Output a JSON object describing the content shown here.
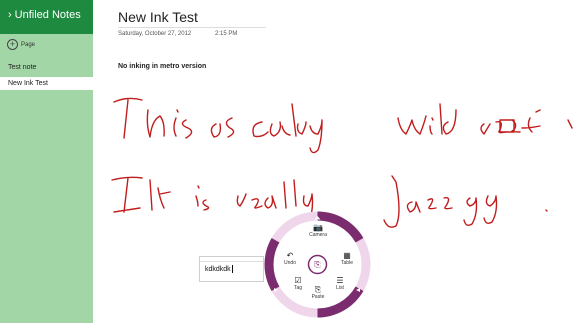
{
  "sidebar": {
    "notebook_title": "Unfiled Notes",
    "add_page_label": "Page",
    "pages": [
      "Test note",
      "New Ink Test"
    ]
  },
  "page": {
    "title": "New Ink Test",
    "date": "Saturday, October 27, 2012",
    "time": "2:15 PM",
    "body_text": "No inking in metro version"
  },
  "textbox": {
    "text": "kdkdkdk"
  },
  "radial_menu": {
    "items": [
      "Camera",
      "Table",
      "List",
      "Paste",
      "Tag",
      "Undo"
    ]
  },
  "colors": {
    "sidebar": "#a3d6a6",
    "header": "#1e8a3f",
    "ink": "#c21d1d",
    "menu_ring": "#7b2c6f"
  }
}
